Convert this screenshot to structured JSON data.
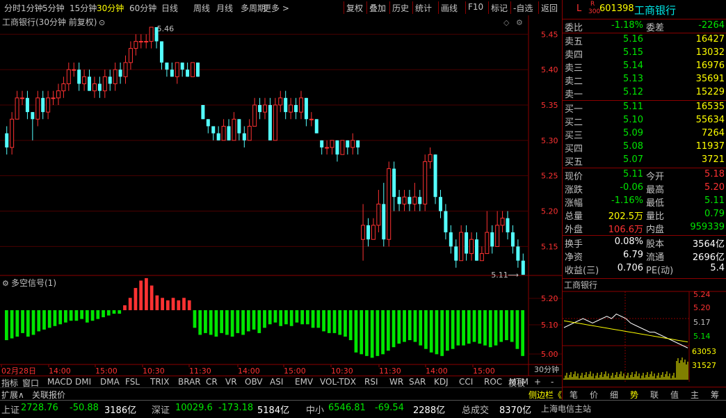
{
  "colors": {
    "up": "#ff3232",
    "down": "#00e600",
    "flat": "#c0c0c0",
    "candle_down": "#54ffff",
    "ma": "#ffff00",
    "border": "#8b0000"
  },
  "toolbar": {
    "periods": [
      "分时",
      "1分钟",
      "5分钟",
      "15分钟",
      "30分钟",
      "60分钟",
      "日线",
      "周线",
      "月线",
      "多周期",
      "更多 >"
    ],
    "active_period": "30分钟",
    "tools": [
      "复权",
      "叠加",
      "历史",
      "统计",
      "画线",
      "F10",
      "标记",
      "-自选",
      "返回"
    ]
  },
  "chart_header": {
    "title": "工商银行(30分钟 前复权)",
    "collapse_icon": "chevron-down-icon"
  },
  "price_axis": {
    "labels": [
      "5.45",
      "5.40",
      "5.35",
      "5.30",
      "5.25",
      "5.20",
      "5.15"
    ]
  },
  "annotations": {
    "high": "5.46",
    "last": "5.11"
  },
  "indicator": {
    "title": "多空信号(1)",
    "axis_labels": [
      "5.20",
      "5.10",
      "5.00"
    ]
  },
  "time_axis": {
    "labels": [
      "02月28日",
      "14:00",
      "15:00",
      "10:30",
      "11:30",
      "14:00",
      "15:00",
      "10:30",
      "11:30",
      "14:00",
      "15:00"
    ],
    "period_label": "30分钟"
  },
  "chart_data": {
    "type": "candlestick",
    "ylim": [
      5.115,
      5.465
    ],
    "candles": [
      [
        5.31,
        5.29,
        5.32,
        5.28
      ],
      [
        5.29,
        5.33,
        5.34,
        5.28
      ],
      [
        5.33,
        5.36,
        5.37,
        5.33
      ],
      [
        5.36,
        5.36,
        5.37,
        5.35
      ],
      [
        5.36,
        5.34,
        5.37,
        5.33
      ],
      [
        5.34,
        5.33,
        5.34,
        5.3
      ],
      [
        5.33,
        5.36,
        5.37,
        5.32
      ],
      [
        5.36,
        5.34,
        5.37,
        5.33
      ],
      [
        5.34,
        5.36,
        5.37,
        5.33
      ],
      [
        5.36,
        5.36,
        5.37,
        5.35
      ],
      [
        5.36,
        5.37,
        5.38,
        5.35
      ],
      [
        5.37,
        5.38,
        5.39,
        5.36
      ],
      [
        5.38,
        5.4,
        5.41,
        5.37
      ],
      [
        5.4,
        5.4,
        5.41,
        5.39
      ],
      [
        5.4,
        5.38,
        5.41,
        5.37
      ],
      [
        5.38,
        5.39,
        5.4,
        5.37
      ],
      [
        5.39,
        5.37,
        5.4,
        5.37
      ],
      [
        5.37,
        5.38,
        5.39,
        5.36
      ],
      [
        5.38,
        5.37,
        5.39,
        5.36
      ],
      [
        5.37,
        5.39,
        5.4,
        5.36
      ],
      [
        5.39,
        5.38,
        5.4,
        5.37
      ],
      [
        5.38,
        5.4,
        5.41,
        5.37
      ],
      [
        5.4,
        5.39,
        5.41,
        5.38
      ],
      [
        5.39,
        5.41,
        5.42,
        5.38
      ],
      [
        5.41,
        5.43,
        5.44,
        5.4
      ],
      [
        5.43,
        5.44,
        5.45,
        5.42
      ],
      [
        5.44,
        5.44,
        5.45,
        5.43
      ],
      [
        5.44,
        5.44,
        5.45,
        5.43
      ],
      [
        5.44,
        5.46,
        5.46,
        5.43
      ],
      [
        5.46,
        5.44,
        5.46,
        5.43
      ],
      [
        5.44,
        5.41,
        5.44,
        5.4
      ],
      [
        5.41,
        5.4,
        5.41,
        5.39
      ],
      [
        5.4,
        5.39,
        5.41,
        5.39
      ],
      [
        5.39,
        5.41,
        5.41,
        5.38
      ],
      [
        5.41,
        5.4,
        5.41,
        5.39
      ],
      [
        5.4,
        5.39,
        5.41,
        5.39
      ],
      [
        5.39,
        5.41,
        5.41,
        5.39
      ],
      [
        5.41,
        5.39,
        5.41,
        5.39
      ],
      [
        5.35,
        5.33,
        5.35,
        5.33
      ],
      [
        5.33,
        5.32,
        5.33,
        5.31
      ],
      [
        5.32,
        5.31,
        5.32,
        5.3
      ],
      [
        5.31,
        5.3,
        5.32,
        5.3
      ],
      [
        5.3,
        5.32,
        5.33,
        5.3
      ],
      [
        5.32,
        5.3,
        5.33,
        5.3
      ],
      [
        5.3,
        5.33,
        5.34,
        5.3
      ],
      [
        5.33,
        5.31,
        5.33,
        5.3
      ],
      [
        5.31,
        5.3,
        5.32,
        5.29
      ],
      [
        5.3,
        5.32,
        5.33,
        5.3
      ],
      [
        5.32,
        5.35,
        5.36,
        5.32
      ],
      [
        5.35,
        5.34,
        5.36,
        5.33
      ],
      [
        5.34,
        5.35,
        5.36,
        5.33
      ],
      [
        5.35,
        5.3,
        5.36,
        5.3
      ],
      [
        5.3,
        5.35,
        5.36,
        5.3
      ],
      [
        5.35,
        5.36,
        5.37,
        5.34
      ],
      [
        5.36,
        5.34,
        5.37,
        5.33
      ],
      [
        5.34,
        5.35,
        5.36,
        5.33
      ],
      [
        5.35,
        5.34,
        5.36,
        5.33
      ],
      [
        5.34,
        5.36,
        5.37,
        5.33
      ],
      [
        5.36,
        5.33,
        5.36,
        5.32
      ],
      [
        5.33,
        5.33,
        5.34,
        5.32
      ],
      [
        5.33,
        5.31,
        5.33,
        5.31
      ],
      [
        5.3,
        5.29,
        5.3,
        5.28
      ],
      [
        5.29,
        5.29,
        5.3,
        5.28
      ],
      [
        5.29,
        5.3,
        5.3,
        5.28
      ],
      [
        5.3,
        5.28,
        5.3,
        5.27
      ],
      [
        5.28,
        5.3,
        5.3,
        5.28
      ],
      [
        5.3,
        5.29,
        5.3,
        5.28
      ],
      [
        5.29,
        5.3,
        5.31,
        5.28
      ],
      [
        5.3,
        5.29,
        5.3,
        5.28
      ],
      [
        5.16,
        5.18,
        5.21,
        5.13
      ],
      [
        5.18,
        5.16,
        5.19,
        5.15
      ],
      [
        5.16,
        5.18,
        5.19,
        5.16
      ],
      [
        5.18,
        5.21,
        5.23,
        5.17
      ],
      [
        5.21,
        5.16,
        5.24,
        5.15
      ],
      [
        5.16,
        5.26,
        5.27,
        5.15
      ],
      [
        5.26,
        5.22,
        5.27,
        5.2
      ],
      [
        5.22,
        5.21,
        5.23,
        5.2
      ],
      [
        5.21,
        5.22,
        5.23,
        5.2
      ],
      [
        5.22,
        5.21,
        5.23,
        5.2
      ],
      [
        5.21,
        5.22,
        5.24,
        5.2
      ],
      [
        5.22,
        5.21,
        5.23,
        5.2
      ],
      [
        5.21,
        5.27,
        5.28,
        5.2
      ],
      [
        5.27,
        5.28,
        5.29,
        5.26
      ],
      [
        5.28,
        5.22,
        5.28,
        5.21
      ],
      [
        5.22,
        5.2,
        5.23,
        5.19
      ],
      [
        5.2,
        5.17,
        5.21,
        5.16
      ],
      [
        5.17,
        5.15,
        5.18,
        5.14
      ],
      [
        5.15,
        5.13,
        5.16,
        5.12
      ],
      [
        5.13,
        5.17,
        5.18,
        5.13
      ],
      [
        5.17,
        5.14,
        5.18,
        5.13
      ],
      [
        5.14,
        5.16,
        5.17,
        5.13
      ],
      [
        5.16,
        5.13,
        5.17,
        5.13
      ],
      [
        5.13,
        5.14,
        5.15,
        5.13
      ],
      [
        5.14,
        5.17,
        5.2,
        5.14
      ],
      [
        5.17,
        5.15,
        5.18,
        5.14
      ],
      [
        5.15,
        5.18,
        5.2,
        5.15
      ],
      [
        5.18,
        5.19,
        5.2,
        5.17
      ],
      [
        5.19,
        5.17,
        5.2,
        5.16
      ],
      [
        5.17,
        5.15,
        5.18,
        5.14
      ],
      [
        5.15,
        5.13,
        5.16,
        5.12
      ],
      [
        5.13,
        5.11,
        5.14,
        5.11
      ]
    ],
    "signal": [
      -0.034,
      -0.032,
      -0.03,
      -0.026,
      -0.03,
      -0.028,
      -0.024,
      -0.022,
      -0.02,
      -0.018,
      -0.016,
      -0.014,
      -0.012,
      -0.012,
      -0.01,
      -0.014,
      -0.012,
      -0.01,
      -0.008,
      -0.006,
      -0.004,
      -0.004,
      0.004,
      0.01,
      0.018,
      0.024,
      0.026,
      0.02,
      0.012,
      0.01,
      0.008,
      0.01,
      0.008,
      0.01,
      0.008,
      -0.02,
      -0.028,
      -0.026,
      -0.028,
      -0.03,
      -0.026,
      -0.028,
      -0.03,
      -0.026,
      -0.028,
      -0.024,
      -0.022,
      -0.026,
      -0.02,
      -0.016,
      -0.014,
      -0.018,
      -0.016,
      -0.018,
      -0.014,
      -0.016,
      -0.016,
      -0.02,
      -0.02,
      -0.024,
      -0.026,
      -0.026,
      -0.028,
      -0.03,
      -0.034,
      -0.048,
      -0.05,
      -0.052,
      -0.054,
      -0.052,
      -0.05,
      -0.046,
      -0.042,
      -0.038,
      -0.036,
      -0.034,
      -0.036,
      -0.04,
      -0.044,
      -0.048,
      -0.05,
      -0.052,
      -0.046,
      -0.044,
      -0.04,
      -0.04,
      -0.038,
      -0.036,
      -0.038,
      -0.04,
      -0.042,
      -0.04,
      -0.036,
      -0.034,
      -0.036,
      -0.044,
      -0.052
    ]
  },
  "bottom_tabs": {
    "left": "指标",
    "items": [
      "窗口",
      "MACD",
      "DMI",
      "DMA",
      "FSL",
      "TRIX",
      "BRAR",
      "CR",
      "VR",
      "OBV",
      "ASI",
      "EMV",
      "VOL-TDX",
      "RSI",
      "WR",
      "SAR",
      "KDJ",
      "CCI",
      "ROC",
      "MTM"
    ],
    "template": "模板",
    "plus": "+",
    "minus": "-"
  },
  "bottom_left": {
    "expand": "扩展∧",
    "related": "关联报价"
  },
  "quote": {
    "marker_l": "L",
    "marker_r": "R",
    "marker_300": "300",
    "code": "601398",
    "name": "工商银行",
    "weibi_label": "委比",
    "weibi": "-1.18%",
    "weicha_label": "委差",
    "weicha": "-2264",
    "sells": [
      {
        "label": "卖五",
        "price": "5.16",
        "vol": "16427"
      },
      {
        "label": "卖四",
        "price": "5.15",
        "vol": "13032"
      },
      {
        "label": "卖三",
        "price": "5.14",
        "vol": "16976"
      },
      {
        "label": "卖二",
        "price": "5.13",
        "vol": "35691"
      },
      {
        "label": "卖一",
        "price": "5.12",
        "vol": "15229"
      }
    ],
    "buys": [
      {
        "label": "买一",
        "price": "5.11",
        "vol": "16535"
      },
      {
        "label": "买二",
        "price": "5.10",
        "vol": "55634"
      },
      {
        "label": "买三",
        "price": "5.09",
        "vol": "7264"
      },
      {
        "label": "买四",
        "price": "5.08",
        "vol": "11937"
      },
      {
        "label": "买五",
        "price": "5.07",
        "vol": "3721"
      }
    ],
    "stats": [
      {
        "l1": "现价",
        "v1": "5.11",
        "c1": "down",
        "l2": "今开",
        "v2": "5.18",
        "c2": "up"
      },
      {
        "l1": "涨跌",
        "v1": "-0.06",
        "c1": "down",
        "l2": "最高",
        "v2": "5.20",
        "c2": "up"
      },
      {
        "l1": "涨幅",
        "v1": "-1.16%",
        "c1": "down",
        "l2": "最低",
        "v2": "5.11",
        "c2": "down"
      },
      {
        "l1": "总量",
        "v1": "202.5万",
        "c1": "ma",
        "l2": "量比",
        "v2": "0.79",
        "c2": "down"
      },
      {
        "l1": "外盘",
        "v1": "106.6万",
        "c1": "up",
        "l2": "内盘",
        "v2": "959339",
        "c2": "down"
      }
    ],
    "stats2": [
      {
        "l1": "换手",
        "v1": "0.08%",
        "l2": "股本",
        "v2": "3564亿"
      },
      {
        "l1": "净资",
        "v1": "6.79",
        "l2": "流通",
        "v2": "2696亿"
      },
      {
        "l1": "收益(三)",
        "v1": "0.706",
        "l2": "PE(动)",
        "v2": "5.4"
      }
    ]
  },
  "mini": {
    "title": "工商银行",
    "prices": [
      "5.24",
      "5.20",
      "5.17",
      "5.14"
    ],
    "vols": [
      "63053",
      "31527"
    ],
    "tabs": [
      "笔",
      "价",
      "细",
      "势",
      "联",
      "值",
      "主",
      "筹"
    ],
    "active_tab": "势"
  },
  "side_label": "侧边栏《",
  "status": {
    "sh_label": "上证",
    "sh": "2728.76",
    "sh_chg": "-50.88",
    "sh_amt": "3186亿",
    "sz_label": "深证",
    "sz": "10029.6",
    "sz_chg": "-173.18",
    "sz_amt": "5184亿",
    "zx_label": "中小",
    "zx": "6546.81",
    "zx_chg": "-69.54",
    "zx_amt": "2288亿",
    "total_label": "总成交",
    "total": "8370亿",
    "server": "上海电信主站"
  }
}
